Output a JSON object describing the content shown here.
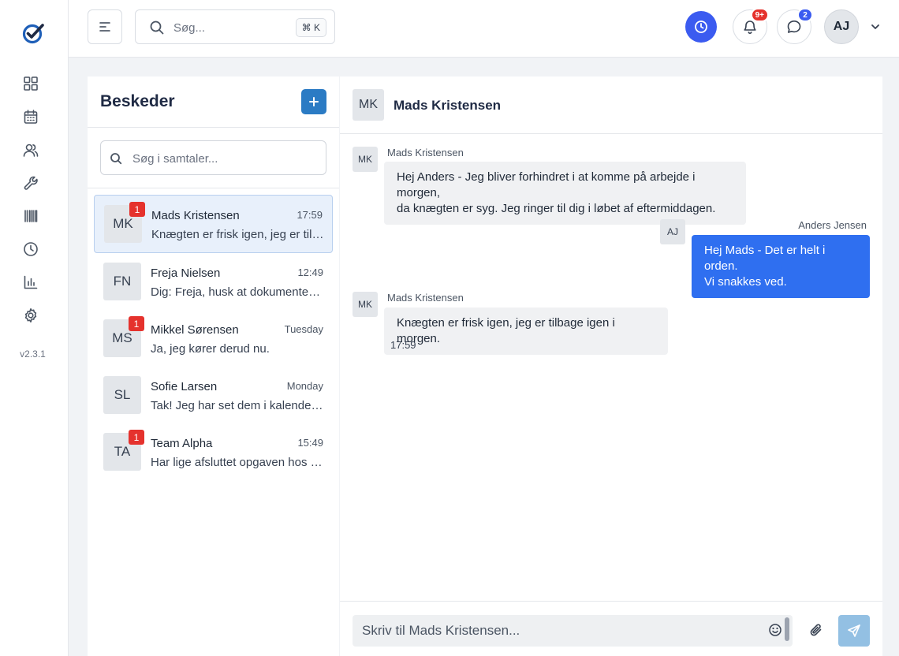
{
  "app": {
    "version": "v2.3.1",
    "accent": "#3b5bf0",
    "icons": [
      "logo-check-icon",
      "dashboard-icon",
      "calendar-icon",
      "users-icon",
      "wrench-icon",
      "barcode-icon",
      "clock-icon",
      "bar-chart-icon",
      "gear-icon"
    ]
  },
  "topbar": {
    "search_placeholder": "Søg...",
    "shortcut": "⌘ K",
    "notifications_badge": "9+",
    "messages_badge": "2",
    "user_initials": "AJ"
  },
  "conversations": {
    "title": "Beskeder",
    "search_placeholder": "Søg i samtaler...",
    "items": [
      {
        "initials": "MK",
        "name": "Mads Kristensen",
        "time": "17:59",
        "preview": "Knægten er frisk igen, jeg er tilbage igen i morgen.",
        "unread": "1",
        "active": true
      },
      {
        "initials": "FN",
        "name": "Freja Nielsen",
        "time": "12:49",
        "preview": "Dig: Freja, husk at dokumentere arbejdet.",
        "unread": "",
        "active": false
      },
      {
        "initials": "MS",
        "name": "Mikkel Sørensen",
        "time": "Tuesday",
        "preview": "Ja, jeg kører derud nu.",
        "unread": "1",
        "active": false
      },
      {
        "initials": "SL",
        "name": "Sofie Larsen",
        "time": "Monday",
        "preview": "Tak! Jeg har set dem i kalenderen.",
        "unread": "",
        "active": false
      },
      {
        "initials": "TA",
        "name": "Team Alpha",
        "time": "15:49",
        "preview": "Har lige afsluttet opgaven hos Ejendommen.",
        "unread": "1",
        "active": false
      }
    ]
  },
  "chat": {
    "contact_initials": "MK",
    "contact_name": "Mads Kristensen",
    "messages": [
      {
        "initials": "MK",
        "sender": "Mads Kristensen",
        "line1": "Hej Anders - Jeg bliver forhindret i at komme på arbejde i morgen,",
        "line2": "da knægten er syg. Jeg ringer til dig i løbet af eftermiddagen."
      },
      {
        "initials": "AJ",
        "sender": "Anders Jensen",
        "line1": "Hej Mads - Det er helt i orden.",
        "line2": "Vi snakkes ved."
      },
      {
        "initials": "MK",
        "sender": "Mads Kristensen",
        "line1": "Knægten er frisk igen, jeg er tilbage igen i morgen.",
        "time": "17:59"
      }
    ],
    "composer_placeholder": "Skriv til Mads Kristensen..."
  }
}
